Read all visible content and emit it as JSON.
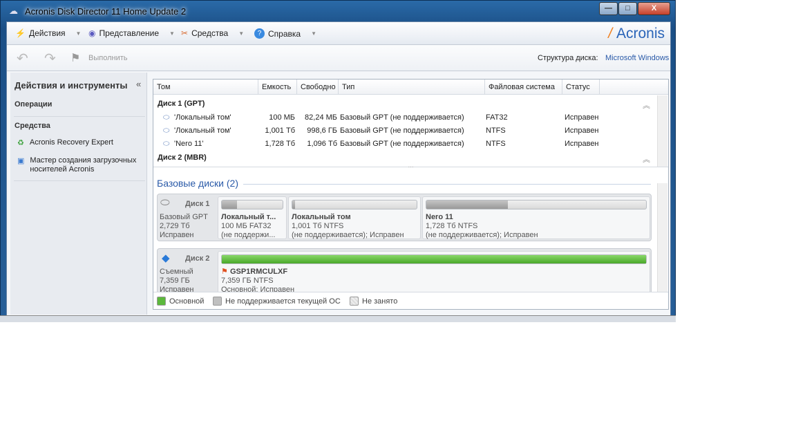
{
  "window": {
    "title": "Acronis Disk Director 11 Home Update 2",
    "minimize": "—",
    "maximize": "□",
    "close": "X"
  },
  "menu": [
    {
      "label": "Действия"
    },
    {
      "label": "Представление"
    },
    {
      "label": "Средства"
    },
    {
      "label": "Справка"
    }
  ],
  "logo": "Acronis",
  "toolbar": {
    "run": "Выполнить",
    "disk_layout_label": "Структура диска:",
    "disk_layout_value": "Microsoft Windows"
  },
  "sidebar": {
    "title": "Действия и инструменты",
    "collapse": "«",
    "operations": "Операции",
    "tools": "Средства",
    "items": [
      {
        "label": "Acronis Recovery Expert"
      },
      {
        "label": "Мастер создания загрузочных носителей Acronis"
      }
    ]
  },
  "table": {
    "columns": [
      "Том",
      "Емкость",
      "Свободно",
      "Тип",
      "Файловая система",
      "Статус"
    ],
    "groups": [
      {
        "label": "Диск 1 (GPT)",
        "rows": [
          {
            "name": "'Локальный том'",
            "cap": "100 МБ",
            "free": "82,24 МБ",
            "type": "Базовый GPT (не поддерживается)",
            "fs": "FAT32",
            "status": "Исправен"
          },
          {
            "name": "'Локальный том'",
            "cap": "1,001 Тб",
            "free": "998,6 ГБ",
            "type": "Базовый GPT (не поддерживается)",
            "fs": "NTFS",
            "status": "Исправен"
          },
          {
            "name": "'Nero 11'",
            "cap": "1,728 Тб",
            "free": "1,096 Тб",
            "type": "Базовый GPT (не поддерживается)",
            "fs": "NTFS",
            "status": "Исправен"
          }
        ]
      },
      {
        "label": "Диск 2 (MBR)"
      }
    ]
  },
  "disks_title": "Базовые диски (2)",
  "disks": [
    {
      "name": "Диск 1",
      "type": "Базовый GPT",
      "size": "2,729 Тб",
      "status": "Исправен",
      "partitions": [
        {
          "name": "Локальный т...",
          "info": "100 МБ FAT32",
          "status": " (не поддержи...",
          "used": 0.25
        },
        {
          "name": "Локальный том",
          "info": "1,001 Тб NTFS",
          "status": " (не поддерживается); Исправен",
          "used": 0.02
        },
        {
          "name": "Nero 11",
          "info": "1,728 Тб NTFS",
          "status": " (не поддерживается); Исправен",
          "used": 0.37
        }
      ]
    },
    {
      "name": "Диск 2",
      "type": "Съемный",
      "size": "7,359 ГБ",
      "status": "Исправен",
      "partitions": [
        {
          "name": "GSP1RMCULXF",
          "info": "7,359 ГБ NTFS",
          "status": "Основной; Исправен",
          "used": 1.0
        }
      ]
    }
  ],
  "legend": [
    "Основной",
    "Не поддерживается текущей ОС",
    "Не занято"
  ],
  "colors": {
    "primary": "#5cb83c",
    "unsupported": "#b0b0b0",
    "accent": "#2a64b8"
  }
}
